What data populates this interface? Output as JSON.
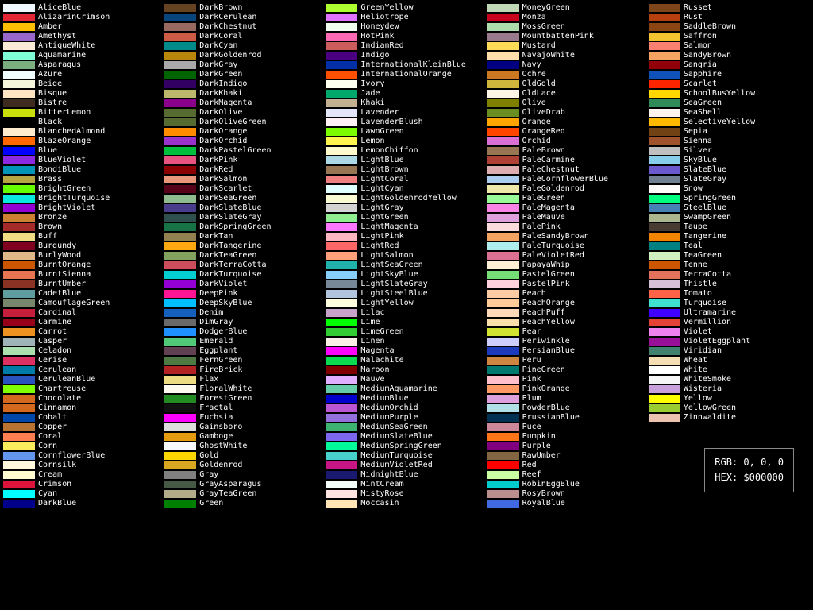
{
  "columns": [
    [
      {
        "name": "AliceBlue",
        "color": "#F0F8FF"
      },
      {
        "name": "AlizarinCrimson",
        "color": "#E32636"
      },
      {
        "name": "Amber",
        "color": "#FFBF00"
      },
      {
        "name": "Amethyst",
        "color": "#9966CC"
      },
      {
        "name": "AntiqueWhite",
        "color": "#FAEBD7"
      },
      {
        "name": "Aquamarine",
        "color": "#7FFFD4"
      },
      {
        "name": "Asparagus",
        "color": "#7BAE7F"
      },
      {
        "name": "Azure",
        "color": "#F0FFFF"
      },
      {
        "name": "Beige",
        "color": "#F5F5DC"
      },
      {
        "name": "Bisque",
        "color": "#FFE4C4"
      },
      {
        "name": "Bistre",
        "color": "#3D2B1F"
      },
      {
        "name": "BitterLemon",
        "color": "#CAE00D"
      },
      {
        "name": "Black",
        "color": "#000000"
      },
      {
        "name": "BlanchedAlmond",
        "color": "#FFEBCD"
      },
      {
        "name": "BlazeOrange",
        "color": "#FF6700"
      },
      {
        "name": "Blue",
        "color": "#0000FF"
      },
      {
        "name": "BlueViolet",
        "color": "#8A2BE2"
      },
      {
        "name": "BondiBlue",
        "color": "#0095B6"
      },
      {
        "name": "Brass",
        "color": "#B5A642"
      },
      {
        "name": "BrightGreen",
        "color": "#66FF00"
      },
      {
        "name": "BrightTurquoise",
        "color": "#08E8DE"
      },
      {
        "name": "BrightViolet",
        "color": "#9400D3"
      },
      {
        "name": "Bronze",
        "color": "#CD7F32"
      },
      {
        "name": "Brown",
        "color": "#A52A2A"
      },
      {
        "name": "Buff",
        "color": "#F0DC82"
      },
      {
        "name": "Burgundy",
        "color": "#800020"
      },
      {
        "name": "BurlyWood",
        "color": "#DEB887"
      },
      {
        "name": "BurntOrange",
        "color": "#CC5500"
      },
      {
        "name": "BurntSienna",
        "color": "#E97451"
      },
      {
        "name": "BurntUmber",
        "color": "#8A3324"
      },
      {
        "name": "CadetBlue",
        "color": "#5F9EA0"
      },
      {
        "name": "CamouflageGreen",
        "color": "#78866B"
      },
      {
        "name": "Cardinal",
        "color": "#C41E3A"
      },
      {
        "name": "Carmine",
        "color": "#960018"
      },
      {
        "name": "Carrot",
        "color": "#ED9121"
      },
      {
        "name": "Casper",
        "color": "#9EB4B7"
      },
      {
        "name": "Celadon",
        "color": "#ACE1AF"
      },
      {
        "name": "Cerise",
        "color": "#DE3163"
      },
      {
        "name": "Cerulean",
        "color": "#007BA7"
      },
      {
        "name": "CeruleanBlue",
        "color": "#2A52BE"
      },
      {
        "name": "Chartreuse",
        "color": "#7FFF00"
      },
      {
        "name": "Chocolate",
        "color": "#D2691E"
      },
      {
        "name": "Cinnamon",
        "color": "#D2691E"
      },
      {
        "name": "Cobalt",
        "color": "#0047AB"
      },
      {
        "name": "Copper",
        "color": "#B87333"
      },
      {
        "name": "Coral",
        "color": "#FF7F50"
      },
      {
        "name": "Corn",
        "color": "#FBEC5D"
      },
      {
        "name": "CornflowerBlue",
        "color": "#6495ED"
      },
      {
        "name": "Cornsilk",
        "color": "#FFF8DC"
      },
      {
        "name": "Cream",
        "color": "#FFFDD0"
      },
      {
        "name": "Crimson",
        "color": "#DC143C"
      },
      {
        "name": "Cyan",
        "color": "#00FFFF"
      },
      {
        "name": "DarkBlue",
        "color": "#00008B"
      }
    ],
    [
      {
        "name": "DarkBrown",
        "color": "#654321"
      },
      {
        "name": "DarkCerulean",
        "color": "#08457E"
      },
      {
        "name": "DarkChestnut",
        "color": "#986960"
      },
      {
        "name": "DarkCoral",
        "color": "#CD5B45"
      },
      {
        "name": "DarkCyan",
        "color": "#008B8B"
      },
      {
        "name": "DarkGoldenrod",
        "color": "#B8860B"
      },
      {
        "name": "DarkGray",
        "color": "#A9A9A9"
      },
      {
        "name": "DarkGreen",
        "color": "#006400"
      },
      {
        "name": "DarkIndigo",
        "color": "#310062"
      },
      {
        "name": "DarkKhaki",
        "color": "#BDB76B"
      },
      {
        "name": "DarkMagenta",
        "color": "#8B008B"
      },
      {
        "name": "DarkOlive",
        "color": "#556B2F"
      },
      {
        "name": "DarkOliveGreen",
        "color": "#556B2F"
      },
      {
        "name": "DarkOrange",
        "color": "#FF8C00"
      },
      {
        "name": "DarkOrchid",
        "color": "#9932CC"
      },
      {
        "name": "DarkPastelGreen",
        "color": "#03C03C"
      },
      {
        "name": "DarkPink",
        "color": "#E75480"
      },
      {
        "name": "DarkRed",
        "color": "#8B0000"
      },
      {
        "name": "DarkSalmon",
        "color": "#E9967A"
      },
      {
        "name": "DarkScarlet",
        "color": "#560319"
      },
      {
        "name": "DarkSeaGreen",
        "color": "#8FBC8F"
      },
      {
        "name": "DarkSlateBlue",
        "color": "#483D8B"
      },
      {
        "name": "DarkSlateGray",
        "color": "#2F4F4F"
      },
      {
        "name": "DarkSpringGreen",
        "color": "#177245"
      },
      {
        "name": "DarkTan",
        "color": "#918151"
      },
      {
        "name": "DarkTangerine",
        "color": "#FFA812"
      },
      {
        "name": "DarkTeaGreen",
        "color": "#82A05E"
      },
      {
        "name": "DarkTerraCotta",
        "color": "#CC4E5C"
      },
      {
        "name": "DarkTurquoise",
        "color": "#00CED1"
      },
      {
        "name": "DarkViolet",
        "color": "#9400D3"
      },
      {
        "name": "DeepPink",
        "color": "#FF1493"
      },
      {
        "name": "DeepSkyBlue",
        "color": "#00BFFF"
      },
      {
        "name": "Denim",
        "color": "#1560BD"
      },
      {
        "name": "DimGray",
        "color": "#696969"
      },
      {
        "name": "DodgerBlue",
        "color": "#1E90FF"
      },
      {
        "name": "Emerald",
        "color": "#50C878"
      },
      {
        "name": "Eggplant",
        "color": "#614051"
      },
      {
        "name": "FernGreen",
        "color": "#4F7942"
      },
      {
        "name": "FireBrick",
        "color": "#B22222"
      },
      {
        "name": "Flax",
        "color": "#EEDC82"
      },
      {
        "name": "FloralWhite",
        "color": "#FFFAF0"
      },
      {
        "name": "ForestGreen",
        "color": "#228B22"
      },
      {
        "name": "Fractal",
        "color": "#111111"
      },
      {
        "name": "Fuchsia",
        "color": "#FF00FF"
      },
      {
        "name": "Gainsboro",
        "color": "#DCDCDC"
      },
      {
        "name": "Gamboge",
        "color": "#E49B0F"
      },
      {
        "name": "GhostWhite",
        "color": "#F8F8FF"
      },
      {
        "name": "Gold",
        "color": "#FFD700"
      },
      {
        "name": "Goldenrod",
        "color": "#DAA520"
      },
      {
        "name": "Gray",
        "color": "#808080"
      },
      {
        "name": "GrayAsparagus",
        "color": "#465945"
      },
      {
        "name": "GrayTeaGreen",
        "color": "#B2AC88"
      },
      {
        "name": "Green",
        "color": "#008000"
      }
    ],
    [
      {
        "name": "GreenYellow",
        "color": "#ADFF2F"
      },
      {
        "name": "Heliotrope",
        "color": "#DF73FF"
      },
      {
        "name": "Honeydew",
        "color": "#F0FFF0"
      },
      {
        "name": "HotPink",
        "color": "#FF69B4"
      },
      {
        "name": "IndianRed",
        "color": "#CD5C5C"
      },
      {
        "name": "Indigo",
        "color": "#4B0082"
      },
      {
        "name": "InternationalKleinBlue",
        "color": "#002FA7"
      },
      {
        "name": "InternationalOrange",
        "color": "#FF4F00"
      },
      {
        "name": "Ivory",
        "color": "#FFFFF0"
      },
      {
        "name": "Jade",
        "color": "#00A86B"
      },
      {
        "name": "Khaki",
        "color": "#C3B091"
      },
      {
        "name": "Lavender",
        "color": "#E6E6FA"
      },
      {
        "name": "LavenderBlush",
        "color": "#FFF0F5"
      },
      {
        "name": "LawnGreen",
        "color": "#7CFC00"
      },
      {
        "name": "Lemon",
        "color": "#FFF44F"
      },
      {
        "name": "LemonChiffon",
        "color": "#FFFACD"
      },
      {
        "name": "LightBlue",
        "color": "#ADD8E6"
      },
      {
        "name": "LightBrown",
        "color": "#987654"
      },
      {
        "name": "LightCoral",
        "color": "#F08080"
      },
      {
        "name": "LightCyan",
        "color": "#E0FFFF"
      },
      {
        "name": "LightGoldenrodYellow",
        "color": "#FAFAD2"
      },
      {
        "name": "LightGray",
        "color": "#D3D3D3"
      },
      {
        "name": "LightGreen",
        "color": "#90EE90"
      },
      {
        "name": "LightMagenta",
        "color": "#FF77FF"
      },
      {
        "name": "LightPink",
        "color": "#FFB6C1"
      },
      {
        "name": "LightRed",
        "color": "#FF6666"
      },
      {
        "name": "LightSalmon",
        "color": "#FFA07A"
      },
      {
        "name": "LightSeaGreen",
        "color": "#20B2AA"
      },
      {
        "name": "LightSkyBlue",
        "color": "#87CEFA"
      },
      {
        "name": "LightSlateGray",
        "color": "#778899"
      },
      {
        "name": "LightSteelBlue",
        "color": "#B0C4DE"
      },
      {
        "name": "LightYellow",
        "color": "#FFFFE0"
      },
      {
        "name": "Lilac",
        "color": "#C8A2C8"
      },
      {
        "name": "Lime",
        "color": "#00FF00"
      },
      {
        "name": "LimeGreen",
        "color": "#32CD32"
      },
      {
        "name": "Linen",
        "color": "#FAF0E6"
      },
      {
        "name": "Magenta",
        "color": "#FF00FF"
      },
      {
        "name": "Malachite",
        "color": "#0BDA51"
      },
      {
        "name": "Maroon",
        "color": "#800000"
      },
      {
        "name": "Mauve",
        "color": "#E0B0FF"
      },
      {
        "name": "MediumAquamarine",
        "color": "#66CDAA"
      },
      {
        "name": "MediumBlue",
        "color": "#0000CD"
      },
      {
        "name": "MediumOrchid",
        "color": "#BA55D3"
      },
      {
        "name": "MediumPurple",
        "color": "#9370DB"
      },
      {
        "name": "MediumSeaGreen",
        "color": "#3CB371"
      },
      {
        "name": "MediumSlateBlue",
        "color": "#7B68EE"
      },
      {
        "name": "MediumSpringGreen",
        "color": "#00FA9A"
      },
      {
        "name": "MediumTurquoise",
        "color": "#48D1CC"
      },
      {
        "name": "MediumVioletRed",
        "color": "#C71585"
      },
      {
        "name": "MidnightBlue",
        "color": "#191970"
      },
      {
        "name": "MintCream",
        "color": "#F5FFFA"
      },
      {
        "name": "MistyRose",
        "color": "#FFE4E1"
      },
      {
        "name": "Moccasin",
        "color": "#FFE4B5"
      }
    ],
    [
      {
        "name": "MoneyGreen",
        "color": "#C0D8B6"
      },
      {
        "name": "Monza",
        "color": "#C7031E"
      },
      {
        "name": "MossGreen",
        "color": "#ADDFAD"
      },
      {
        "name": "MountbattenPink",
        "color": "#997A8D"
      },
      {
        "name": "Mustard",
        "color": "#FFDB58"
      },
      {
        "name": "NavajoWhite",
        "color": "#FFDEAD"
      },
      {
        "name": "Navy",
        "color": "#000080"
      },
      {
        "name": "Ochre",
        "color": "#CC7722"
      },
      {
        "name": "OldGold",
        "color": "#CFB53B"
      },
      {
        "name": "OldLace",
        "color": "#FDF5E6"
      },
      {
        "name": "Olive",
        "color": "#808000"
      },
      {
        "name": "OliveDrab",
        "color": "#6B8E23"
      },
      {
        "name": "Orange",
        "color": "#FFA500"
      },
      {
        "name": "OrangeRed",
        "color": "#FF4500"
      },
      {
        "name": "Orchid",
        "color": "#DA70D6"
      },
      {
        "name": "PaleBrown",
        "color": "#987654"
      },
      {
        "name": "PaleCarmine",
        "color": "#AF4035"
      },
      {
        "name": "PaleChestnut",
        "color": "#DDADAF"
      },
      {
        "name": "PaleCornflowerBlue",
        "color": "#ABCDEF"
      },
      {
        "name": "PaleGoldenrod",
        "color": "#EEE8AA"
      },
      {
        "name": "PaleGreen",
        "color": "#98FB98"
      },
      {
        "name": "PaleMagenta",
        "color": "#F984E5"
      },
      {
        "name": "PaleMauve",
        "color": "#DDA0DD"
      },
      {
        "name": "PalePink",
        "color": "#FADADD"
      },
      {
        "name": "PaleSandyBrown",
        "color": "#F4A460"
      },
      {
        "name": "PaleTurquoise",
        "color": "#AFEEEE"
      },
      {
        "name": "PaleVioletRed",
        "color": "#DB7093"
      },
      {
        "name": "PapayaWhip",
        "color": "#FFEFD5"
      },
      {
        "name": "PastelGreen",
        "color": "#77DD77"
      },
      {
        "name": "PastelPink",
        "color": "#FFD1DC"
      },
      {
        "name": "Peach",
        "color": "#FFCBA4"
      },
      {
        "name": "PeachOrange",
        "color": "#FFCC99"
      },
      {
        "name": "PeachPuff",
        "color": "#FFDAB9"
      },
      {
        "name": "PeachYellow",
        "color": "#FADFAD"
      },
      {
        "name": "Pear",
        "color": "#D1E231"
      },
      {
        "name": "Periwinkle",
        "color": "#CCCCFF"
      },
      {
        "name": "PersianBlue",
        "color": "#1C39BB"
      },
      {
        "name": "Peru",
        "color": "#CD853F"
      },
      {
        "name": "PineGreen",
        "color": "#01796F"
      },
      {
        "name": "Pink",
        "color": "#FFC0CB"
      },
      {
        "name": "PinkOrange",
        "color": "#FF9966"
      },
      {
        "name": "Plum",
        "color": "#DDA0DD"
      },
      {
        "name": "PowderBlue",
        "color": "#B0E0E6"
      },
      {
        "name": "PrussianBlue",
        "color": "#003153"
      },
      {
        "name": "Puce",
        "color": "#CC8899"
      },
      {
        "name": "Pumpkin",
        "color": "#FF7518"
      },
      {
        "name": "Purple",
        "color": "#800080"
      },
      {
        "name": "RawUmber",
        "color": "#826644"
      },
      {
        "name": "Red",
        "color": "#FF0000"
      },
      {
        "name": "Reef",
        "color": "#C9FFA2"
      },
      {
        "name": "RobinEggBlue",
        "color": "#00CCCC"
      },
      {
        "name": "RosyBrown",
        "color": "#BC8F8F"
      },
      {
        "name": "RoyalBlue",
        "color": "#4169E1"
      }
    ],
    [
      {
        "name": "Russet",
        "color": "#80461B"
      },
      {
        "name": "Rust",
        "color": "#B7410E"
      },
      {
        "name": "SaddleBrown",
        "color": "#8B4513"
      },
      {
        "name": "Saffron",
        "color": "#F4C430"
      },
      {
        "name": "Salmon",
        "color": "#FA8072"
      },
      {
        "name": "SandyBrown",
        "color": "#F4A460"
      },
      {
        "name": "Sangria",
        "color": "#92000A"
      },
      {
        "name": "Sapphire",
        "color": "#0F52BA"
      },
      {
        "name": "Scarlet",
        "color": "#FF2400"
      },
      {
        "name": "SchoolBusYellow",
        "color": "#FFD800"
      },
      {
        "name": "SeaGreen",
        "color": "#2E8B57"
      },
      {
        "name": "SeaShell",
        "color": "#FFF5EE"
      },
      {
        "name": "SelectiveYellow",
        "color": "#FFBA00"
      },
      {
        "name": "Sepia",
        "color": "#704214"
      },
      {
        "name": "Sienna",
        "color": "#A0522D"
      },
      {
        "name": "Silver",
        "color": "#C0C0C0"
      },
      {
        "name": "SkyBlue",
        "color": "#87CEEB"
      },
      {
        "name": "SlateBlue",
        "color": "#6A5ACD"
      },
      {
        "name": "SlateGray",
        "color": "#708090"
      },
      {
        "name": "Snow",
        "color": "#FFFAFA"
      },
      {
        "name": "SpringGreen",
        "color": "#00FF7F"
      },
      {
        "name": "SteelBlue",
        "color": "#4682B4"
      },
      {
        "name": "SwampGreen",
        "color": "#ACB78E"
      },
      {
        "name": "Taupe",
        "color": "#483C32"
      },
      {
        "name": "Tangerine",
        "color": "#F28500"
      },
      {
        "name": "Teal",
        "color": "#008080"
      },
      {
        "name": "TeaGreen",
        "color": "#D0F0C0"
      },
      {
        "name": "Tenne",
        "color": "#CD5700"
      },
      {
        "name": "TerraCotta",
        "color": "#E2725B"
      },
      {
        "name": "Thistle",
        "color": "#D8BFD8"
      },
      {
        "name": "Tomato",
        "color": "#FF6347"
      },
      {
        "name": "Turquoise",
        "color": "#40E0D0"
      },
      {
        "name": "Ultramarine",
        "color": "#3F00FF"
      },
      {
        "name": "Vermillion",
        "color": "#E34234"
      },
      {
        "name": "Violet",
        "color": "#EE82EE"
      },
      {
        "name": "VioletEggplant",
        "color": "#991199"
      },
      {
        "name": "Viridian",
        "color": "#40826D"
      },
      {
        "name": "Wheat",
        "color": "#F5DEB3"
      },
      {
        "name": "White",
        "color": "#FFFFFF"
      },
      {
        "name": "WhiteSmoke",
        "color": "#F5F5F5"
      },
      {
        "name": "Wisteria",
        "color": "#C9A0DC"
      },
      {
        "name": "Yellow",
        "color": "#FFFF00"
      },
      {
        "name": "YellowGreen",
        "color": "#9ACD32"
      },
      {
        "name": "Zinnwaldite",
        "color": "#EBC2AF"
      }
    ]
  ],
  "info": {
    "rgb": "RGB: 0, 0, 0",
    "hex": "HEX: $000000"
  }
}
